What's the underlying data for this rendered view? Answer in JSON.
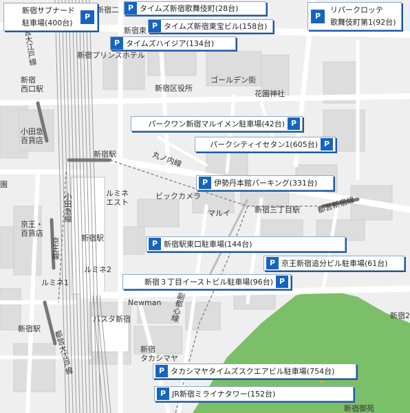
{
  "map": {
    "colors": {
      "background": "#efefef",
      "block": "#e0e0e0",
      "road": "#ffffff",
      "park": "#7bbf69",
      "rail": "#9a9a9a",
      "pin": "#1565c0"
    },
    "pin_label": "P",
    "place_labels": {
      "shinjuku_station": "新宿駅",
      "shinjuku_station_west": "新宿\n西口駅",
      "odakyu_dept": "小田急\n百貨店",
      "odakyu_line": "小田急線",
      "keio_dept": "京王・\n百貨店",
      "keio_line": "京王線",
      "lumine_est": "ルミネ\nエスト",
      "lumine2": "ルミネ2",
      "lumine1": "ルミネ1",
      "big_camera": "ビックカメラ",
      "marui": "マルイ",
      "shinjuku_3chome_sta": "新宿三丁目駅",
      "toei_shinjuku_line": "都営新宿線",
      "marunouchi_line": "丸ノ内線",
      "golden_gai": "ゴールデン街",
      "hanazono_shrine": "花園神社",
      "ward_office": "新宿区役所",
      "prince_hotel": "新宿プリンスホテル",
      "oedo_line_top": "都営大江戸線",
      "oedo_line_bottom": "都営大江戸線",
      "shinjuku_station_bottom": "新宿駅",
      "busta": "バスタ新宿",
      "newman": "Newman",
      "takashimaya": "新宿\nタカシマヤ",
      "fukutoshin_line": "副都心線",
      "shinjuku_east_top": "新宿東",
      "shinjuku_2chome": "新宿2",
      "gyoen": "新宿御苑",
      "park_edge": "園",
      "shinjuku_ni": "新宿二"
    },
    "parking_lots": [
      {
        "id": "sabnard",
        "name": "新宿サブナード\n駐車場(400台)"
      },
      {
        "id": "times_kabukicho",
        "name": "タイムズ新宿歌舞伎町(28台)"
      },
      {
        "id": "times_toho",
        "name": "タイムズ新宿東宝ビル(158台)"
      },
      {
        "id": "times_hygeia",
        "name": "タイムズハイジア(134台)"
      },
      {
        "id": "repark_lotte",
        "name": "リパークロッテ\n歌舞伎町第1(92台)"
      },
      {
        "id": "parkone_marui",
        "name": "パークワン新宿マルイメン駐車場(42台)"
      },
      {
        "id": "parkcity_isetan",
        "name": "パークシティイセタン1(605台)"
      },
      {
        "id": "isetan_honkan",
        "name": "伊勢丹本館パーキング(331台)"
      },
      {
        "id": "east_exit",
        "name": "新宿駅東口駐車場(144台)"
      },
      {
        "id": "keio_oiwake",
        "name": "京王新宿追分ビル駐車場(61台)"
      },
      {
        "id": "3chome_east",
        "name": "新宿３丁目イーストビル駐車場(96台)"
      },
      {
        "id": "takashimaya_times",
        "name": "タカシマヤタイムズスクエアビル駐車場(754台)"
      },
      {
        "id": "jr_mirai",
        "name": "JR新宿ミライナタワー(152台)"
      }
    ]
  }
}
